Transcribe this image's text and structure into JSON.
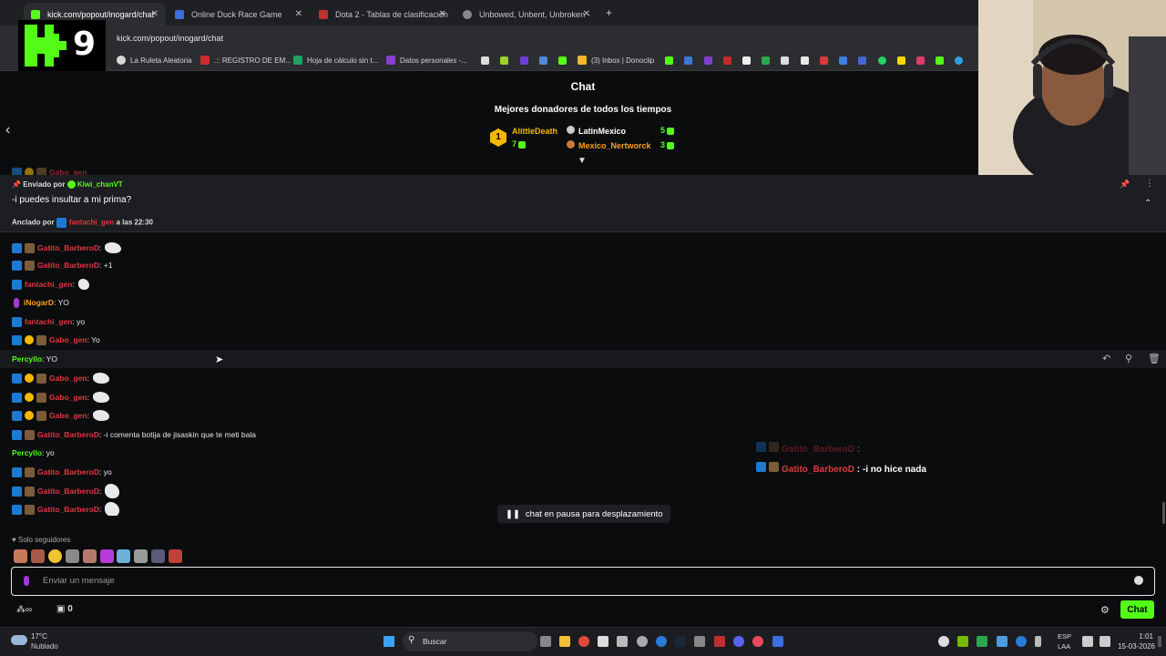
{
  "browser": {
    "tabs": [
      {
        "label": "kick.com/popout/inogard/chat",
        "active": true
      },
      {
        "label": "Online Duck Race Game",
        "active": false
      },
      {
        "label": "Dota 2 - Tablas de clasificación",
        "active": false
      },
      {
        "label": "Unbowed, Unbent, Unbroken -",
        "active": false
      }
    ],
    "url": "kick.com/popout/inogard/chat",
    "bookmarks": [
      "La Ruleta Aleatoria",
      ".:: REGISTRO DE EM...",
      "Hoja de cálculo sin t...",
      "Datos personales -...",
      "(3) Inbox | Donoclip"
    ]
  },
  "overlay_logo": {
    "letter": "K",
    "number": "9"
  },
  "chat": {
    "title": "Chat",
    "donors_title": "Mejores donadores de todos los tiempos",
    "donors": [
      {
        "rank": "1",
        "name": "AlittleDeath",
        "amount": "7"
      },
      {
        "name": "LatinMexico",
        "amount": "5"
      },
      {
        "name": "Mexico_Nertworck",
        "amount": "3"
      }
    ],
    "pinned": {
      "sent_by_label": "Enviado por",
      "sent_by_user": "Kiwi_chanVT",
      "message": "-i puedes insultar a mi prima?",
      "pinned_by_label": "Anclado por",
      "pinned_by_user": "fantachi_gen",
      "pinned_time": "a las 22:30"
    },
    "messages": [
      {
        "user": "Gatito_BarberoD",
        "text": ":",
        "emote": true
      },
      {
        "user": "Gatito_BarberoD",
        "text": ": +1"
      },
      {
        "user": "fantachi_gen",
        "text": ":",
        "emote": true
      },
      {
        "user": "iNogarD",
        "text": ": YO"
      },
      {
        "user": "fantachi_gen",
        "text": ": yo"
      },
      {
        "user": "Gabo_gen",
        "text": ": Yo"
      },
      {
        "user": "Percyllo",
        "text": ": YO"
      },
      {
        "user": "Gabo_gen",
        "text": ":",
        "emote": true
      },
      {
        "user": "Gabo_gen",
        "text": ":",
        "emote": true
      },
      {
        "user": "Gabo_gen",
        "text": ":",
        "emote": true
      },
      {
        "user": "Gatito_BarberoD",
        "text": ": -i comenta botija de jisaskin que te meti bala"
      },
      {
        "user": "Percyllo",
        "text": ": yo"
      },
      {
        "user": "Gatito_BarberoD",
        "text": ": yo"
      },
      {
        "user": "Gatito_BarberoD",
        "text": ":",
        "emote": true
      },
      {
        "user": "Gatito_BarberoD",
        "text": ":",
        "emote": true
      }
    ],
    "overlay_messages": [
      {
        "user": "Gatito_BarberoD",
        "text": ":"
      },
      {
        "user": "Gatito_BarberoD",
        "text": ": -i no hice nada"
      }
    ],
    "pause_label": "chat en pausa para desplazamiento",
    "followers_only": "Solo seguidores",
    "input_placeholder": "Enviar un mensaje",
    "viewer_count": "0",
    "send_label": "Chat"
  },
  "taskbar": {
    "weather_temp": "17°C",
    "weather_desc": "Nublado",
    "search_label": "Buscar",
    "lang": "ESP",
    "lang2": "LAA",
    "time": "1:01",
    "date": "15-03-2026"
  },
  "colors": {
    "kick_green": "#53fc18",
    "username_red": "#e0383e",
    "username_orange": "#ff9d1f",
    "bg": "#0b0c0e"
  }
}
